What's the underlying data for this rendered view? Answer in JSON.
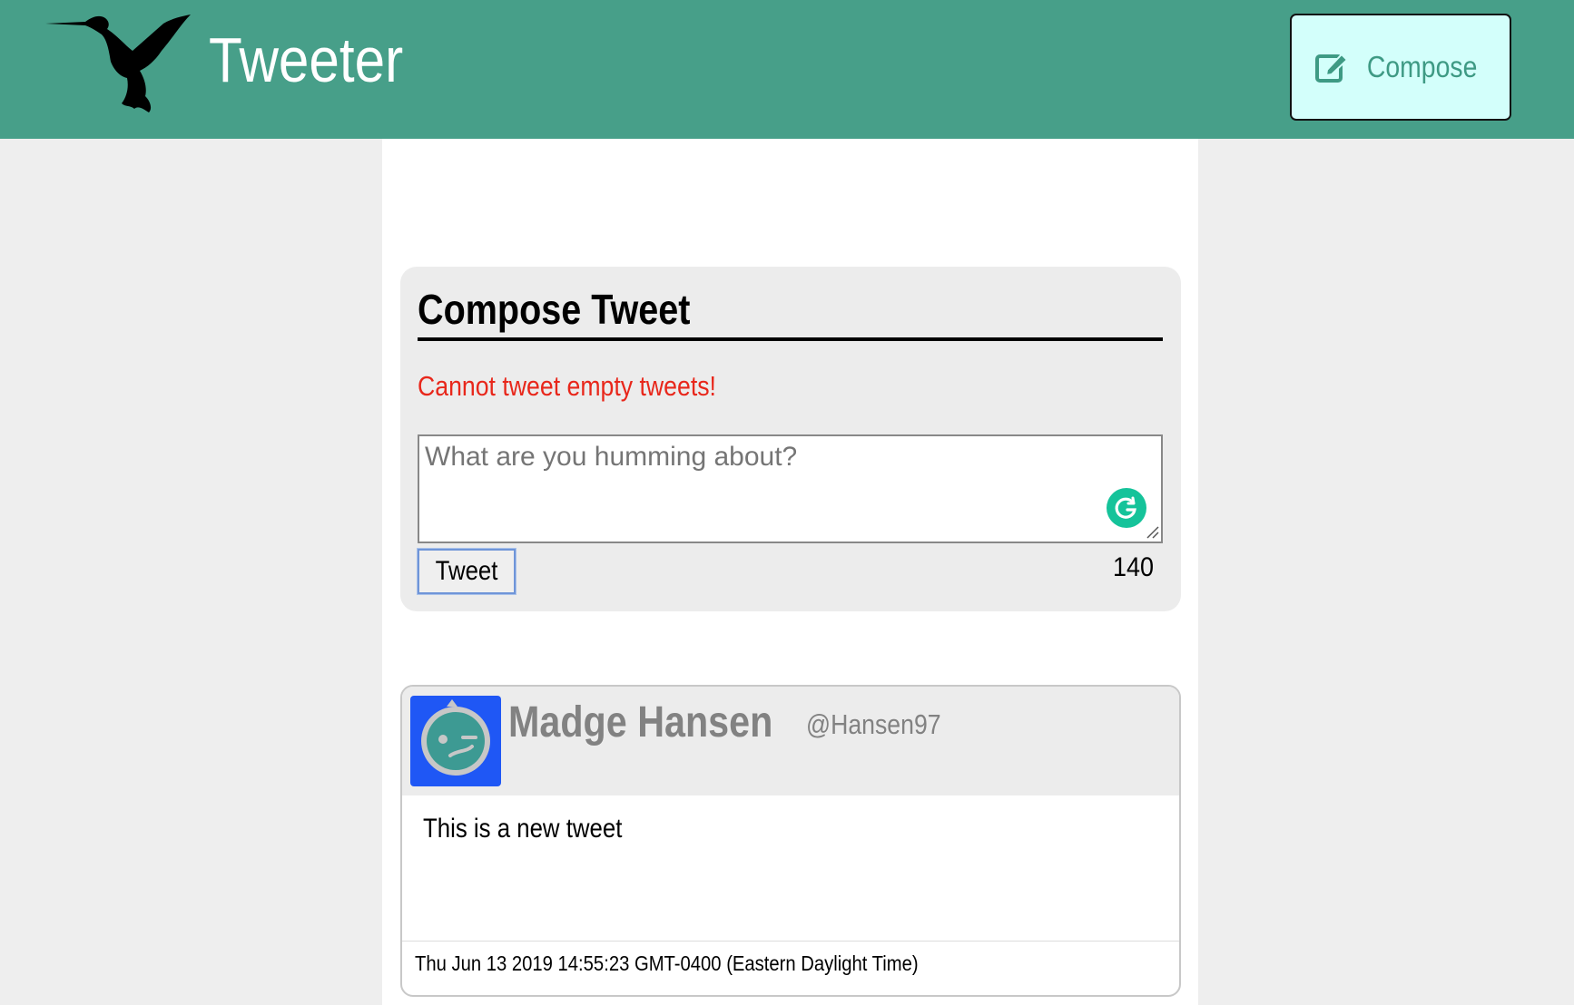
{
  "nav": {
    "brand": "Tweeter",
    "logo_icon": "hummingbird-icon",
    "compose_label": "Compose",
    "compose_icon": "edit-icon"
  },
  "compose": {
    "title": "Compose Tweet",
    "error": "Cannot tweet empty tweets!",
    "placeholder": "What are you humming about?",
    "value": "",
    "submit_label": "Tweet",
    "counter": "140"
  },
  "tweets": [
    {
      "name": "Madge Hansen",
      "handle": "@Hansen97",
      "content": "This is a new tweet",
      "timestamp": "Thu Jun 13 2019 14:55:23 GMT-0400 (Eastern Daylight Time)"
    }
  ],
  "colors": {
    "navbar": "#479f89",
    "compose_button_bg": "#d3fffb",
    "error": "#e8271b",
    "avatar_bg": "#1f57f5",
    "page_bg": "#eeeeee"
  }
}
